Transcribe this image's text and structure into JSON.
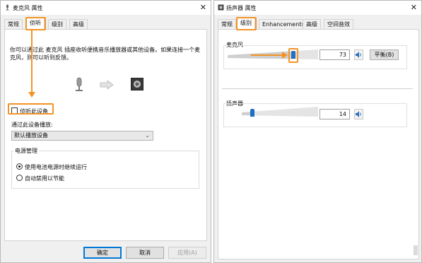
{
  "left": {
    "title": "麦克风 属性",
    "tabs": [
      "常规",
      "侦听",
      "级别",
      "高级"
    ],
    "active_tab": "侦听",
    "description_line1": "你可以通过此 麦克风 插座收听便携音乐播放器或其他设备。如果连接一个麦",
    "description_line2": "克风，则可以听到反馈。",
    "listen_checkbox_label": "侦听此设备",
    "listen_checkbox_checked": false,
    "playback_label": "通过此设备播放:",
    "playback_select": "默认播放设备",
    "power_group_title": "电源管理",
    "radio_continue": "使用电池电源时继续运行",
    "radio_continue_selected": true,
    "radio_auto_disable": "自动禁用以节能",
    "radio_auto_disable_selected": false,
    "buttons": {
      "ok": "确定",
      "cancel": "取消",
      "apply": "应用(A)"
    }
  },
  "right": {
    "title": "扬声器 属性",
    "tabs": [
      "常规",
      "级别",
      "Enhancements",
      "高级",
      "空间音效"
    ],
    "active_tab": "级别",
    "mic_label": "麦克风",
    "mic_value": "73",
    "mic_level_fraction": 0.73,
    "balance_button": "平衡(B)",
    "speaker_label": "扬声器",
    "speaker_value": "14",
    "speaker_level_fraction": 0.14
  },
  "colors": {
    "highlight": "#f39325",
    "slider_thumb": "#1f6fc5",
    "window_bg": "#f0f0f0",
    "primary_border": "#0078d7"
  },
  "icons": [
    "microphone-icon",
    "arrow-right-icon",
    "speaker-icon",
    "speaker-mute-toggle-icon",
    "close-icon",
    "chevron-down-icon"
  ]
}
